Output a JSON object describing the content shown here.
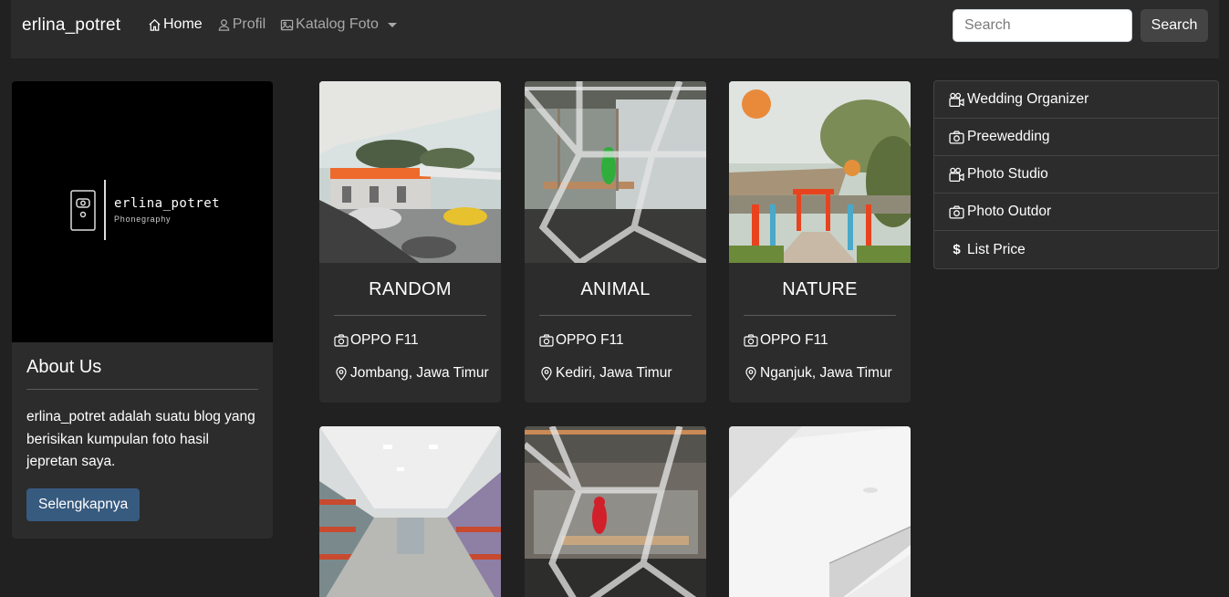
{
  "navbar": {
    "brand": "erlina_potret",
    "links": [
      {
        "label": "Home",
        "icon": "house-icon"
      },
      {
        "label": "Profil",
        "icon": "person-icon"
      },
      {
        "label": "Katalog Foto",
        "icon": "image-icon"
      }
    ],
    "search_placeholder": "Search",
    "search_button": "Search"
  },
  "about": {
    "logo_title": "erlina_potret",
    "logo_subtitle": "Phonegraphy",
    "title": "About Us",
    "text": "erlina_potret adalah suatu blog yang berisikan kumpulan foto hasil jepretan saya.",
    "button": "Selengkapnya"
  },
  "cards": [
    {
      "title": "RANDOM",
      "camera": "OPPO F11",
      "location": "Jombang, Jawa Timur",
      "image": "parking-lot-photo"
    },
    {
      "title": "ANIMAL",
      "camera": "OPPO F11",
      "location": "Kediri, Jawa Timur",
      "image": "green-parrot-photo"
    },
    {
      "title": "NATURE",
      "camera": "OPPO F11",
      "location": "Nganjuk, Jawa Timur",
      "image": "torii-garden-photo"
    },
    {
      "image": "store-aisle-photo"
    },
    {
      "image": "red-parrot-photo"
    },
    {
      "image": "white-ceiling-photo"
    }
  ],
  "list": [
    {
      "label": "Wedding Organizer",
      "icon": "camera-reels-icon"
    },
    {
      "label": "Preewedding",
      "icon": "camera-icon"
    },
    {
      "label": "Photo Studio",
      "icon": "camera-reels-icon"
    },
    {
      "label": "Photo Outdor",
      "icon": "camera-icon"
    },
    {
      "label": "List Price",
      "icon": "dollar-icon"
    }
  ],
  "colors": {
    "background": "#212121",
    "navbar": "#2b2b2b",
    "card": "#2c2c2c",
    "primary_button": "#375a7f",
    "search_button": "#444444"
  }
}
